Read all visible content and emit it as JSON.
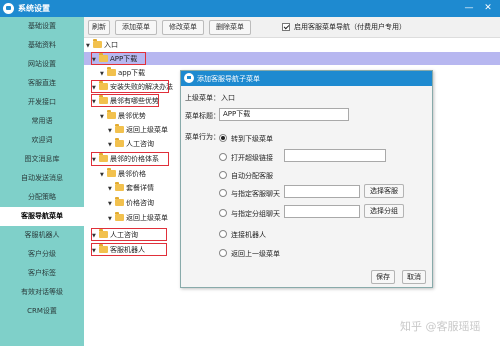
{
  "window": {
    "title": "系统设置",
    "minimize_symbol": "—",
    "close_symbol": "✕"
  },
  "sidebar": {
    "items": [
      {
        "label": "基础设置"
      },
      {
        "label": "基础资料"
      },
      {
        "label": "网站设置"
      },
      {
        "label": "客服直连"
      },
      {
        "label": "开发接口"
      },
      {
        "label": "常用语"
      },
      {
        "label": "欢迎词"
      },
      {
        "label": "图文消息库"
      },
      {
        "label": "自动发送消息"
      },
      {
        "label": "分配策略"
      },
      {
        "label": "客服导航菜单",
        "active": true
      },
      {
        "label": "客服机器人"
      },
      {
        "label": "客户分级"
      },
      {
        "label": "客户标签"
      },
      {
        "label": "有效对话等级"
      },
      {
        "label": "CRM设置"
      }
    ]
  },
  "toolbar": {
    "refresh": "刷新",
    "add": "添加菜单",
    "edit": "修改菜单",
    "delete": "删除菜单",
    "enable_label": "启用客服菜单导航（付费用户专用）",
    "enable_checked": true
  },
  "tree": [
    {
      "label": "入口"
    },
    {
      "label": "APP下载"
    },
    {
      "label": "app下载"
    },
    {
      "label": "安装失败的解决办法"
    },
    {
      "label": "晨邻有哪些优势"
    },
    {
      "label": "晨邻优势"
    },
    {
      "label": "返回上级菜单"
    },
    {
      "label": "人工咨询"
    },
    {
      "label": "晨邻的价格体系"
    },
    {
      "label": "晨邻价格"
    },
    {
      "label": "套餐详情"
    },
    {
      "label": "价格咨询"
    },
    {
      "label": "返回上级菜单"
    },
    {
      "label": "人工咨询"
    },
    {
      "label": "客服机器人"
    }
  ],
  "dialog": {
    "title": "添加客服导航子菜单",
    "parent_label": "上级菜单：",
    "parent_value": "入口",
    "name_label": "菜单标题：",
    "name_value": "APP下载",
    "action_label": "菜单行为：",
    "options": [
      {
        "label": "转到下级菜单",
        "checked": true
      },
      {
        "label": "打开超级链接"
      },
      {
        "label": "自动分配客服"
      },
      {
        "label": "与指定客服聊天",
        "button": "选择客服"
      },
      {
        "label": "与指定分组聊天",
        "button": "选择分组"
      },
      {
        "label": "连接机器人"
      },
      {
        "label": "返回上一级菜单"
      }
    ],
    "save": "保存",
    "cancel": "取消"
  },
  "watermark": "知乎 @客服瑶瑶",
  "colors": {
    "titlebar": "#1e8ad0",
    "sidebar": "#7fd0c9",
    "selected_row": "#b7b7f0",
    "highlight_box": "#e0303a"
  }
}
